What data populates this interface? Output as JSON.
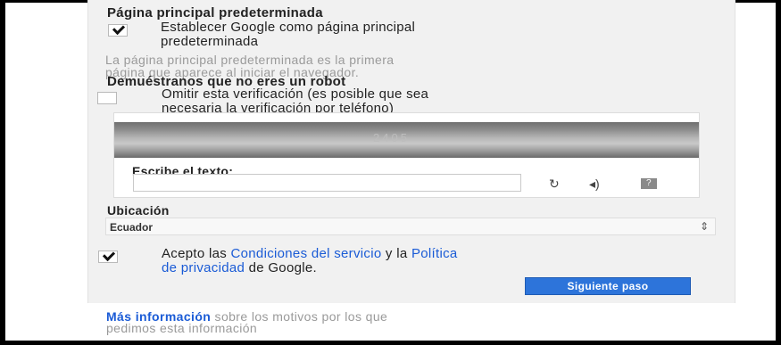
{
  "default_homepage": {
    "heading": "Página principal predeterminada",
    "checkbox_checked": true,
    "checkbox_label_line1": "Establecer Google como página principal",
    "checkbox_label_line2": "predeterminada",
    "hint_line1": "La página principal predeterminada es la primera",
    "hint_line2": "página que aparece al iniciar el navegador."
  },
  "robot_check": {
    "heading": "Demuéstranos que no eres un robot",
    "checkbox_checked": false,
    "checkbox_label_line1": "Omitir esta verificación (es posible que sea",
    "checkbox_label_line2": "necesaria la verificación por teléfono)",
    "captcha_text": "2405",
    "input_label": "Escribe el texto:",
    "input_value": "",
    "icons": [
      "refresh-icon",
      "audio-icon",
      "help-icon"
    ]
  },
  "location": {
    "label": "Ubicación",
    "selected": "Ecuador"
  },
  "terms": {
    "checkbox_checked": true,
    "text_prefix": "Acepto las ",
    "link1": "Condiciones del servicio",
    "text_middle": " y la ",
    "link2_line1": "Política",
    "link2_line2": "de privacidad",
    "text_suffix": " de Google."
  },
  "submit_button": "Siguiente paso",
  "footer": {
    "link": "Más información",
    "text_line1": " sobre los motivos por los que",
    "text_line2": "pedimos esta información"
  },
  "colors": {
    "panel_bg": "#f1f1f1",
    "link": "#1a5bd6",
    "button": "#2d74da"
  }
}
